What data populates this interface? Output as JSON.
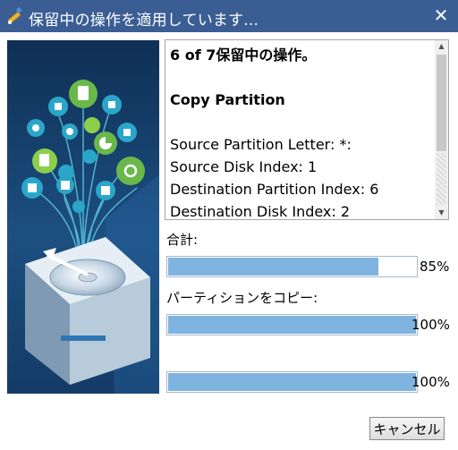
{
  "window": {
    "title": "保留中の操作を適用しています...",
    "close_symbol": "✕",
    "title_icon": "pencil-wand-icon"
  },
  "log": {
    "heading": "6 of 7保留中の操作。",
    "operation": "Copy Partition",
    "lines": [
      "Source Partition Letter: *:",
      "Source Disk Index: 1",
      "Destination Partition Index: 6",
      "Destination Disk Index: 2"
    ]
  },
  "progress": {
    "total_label": "合計:",
    "total_percent_text": "85%",
    "total_value": 0.85,
    "copy_label": "パーティションをコピー:",
    "copy_percent_text": "100%",
    "copy_value": 1.0,
    "third_percent_text": "100%",
    "third_value": 1.0
  },
  "buttons": {
    "cancel": "キャンセル"
  },
  "colors": {
    "titlebar": "#3a5e94",
    "progress_fill": "#7fb3e0",
    "illustration_bg": "#173d6b"
  }
}
